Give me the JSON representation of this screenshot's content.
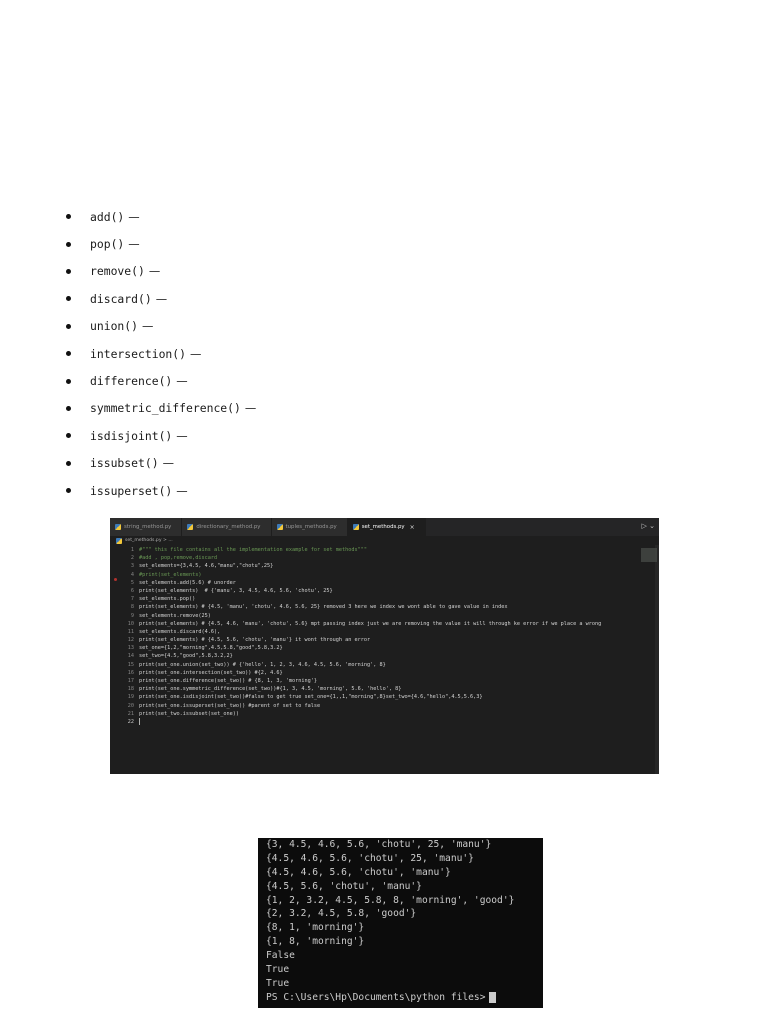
{
  "methods": [
    {
      "name": "add()",
      "dash": "—"
    },
    {
      "name": "pop()",
      "dash": "—"
    },
    {
      "name": "remove()",
      "dash": "—"
    },
    {
      "name": "discard()",
      "dash": "—"
    },
    {
      "name": "union()",
      "dash": "—"
    },
    {
      "name": "intersection()",
      "dash": "—"
    },
    {
      "name": "difference()",
      "dash": "—"
    },
    {
      "name": "symmetric_difference()",
      "dash": "—"
    },
    {
      "name": "isdisjoint()",
      "dash": "—"
    },
    {
      "name": "issubset()",
      "dash": "—"
    },
    {
      "name": "issuperset()",
      "dash": "—"
    }
  ],
  "editor": {
    "tabs": [
      {
        "label": "string_method.py",
        "active": false,
        "icon": "python-file-icon"
      },
      {
        "label": "directionary_method.py",
        "active": false,
        "icon": "python-file-icon"
      },
      {
        "label": "tuples_methods.py",
        "active": false,
        "icon": "python-file-icon"
      },
      {
        "label": "set_methods.py",
        "active": true,
        "icon": "python-file-icon"
      }
    ],
    "close_glyph": "×",
    "run_glyph": "▷ ⌄",
    "breadcrumb": "set_methods.py > ...",
    "lines": [
      {
        "num": "1",
        "text": "#\"\"\" this file contains all the implementation example for set methods\"\"\"",
        "kind": "comment"
      },
      {
        "num": "2",
        "text": "#add , pop,remove,discard",
        "kind": "comment"
      },
      {
        "num": "3",
        "text": "set_elements={3,4.5, 4.6,\"manu\",\"chotu\",25}",
        "kind": "code"
      },
      {
        "num": "4",
        "text": "#print(set_elements)",
        "kind": "comment"
      },
      {
        "num": "5",
        "text": "set_elements.add(5.6) # unorder",
        "kind": "code"
      },
      {
        "num": "6",
        "text": "print(set_elements)  # {'manu', 3, 4.5, 4.6, 5.6, 'chotu', 25}",
        "kind": "code"
      },
      {
        "num": "7",
        "text": "set_elements.pop()",
        "kind": "code"
      },
      {
        "num": "8",
        "text": "print(set_elements) # {4.5, 'manu', 'chotu', 4.6, 5.6, 25} removed 3 here we index we wont able to gave value in index",
        "kind": "code"
      },
      {
        "num": "9",
        "text": "set_elements.remove(25)",
        "kind": "code"
      },
      {
        "num": "10",
        "text": "print(set_elements) # {4.5, 4.6, 'manu', 'chotu', 5.6} mpt passing index just we are removing the value it will through ke error if we place a wrong",
        "kind": "code"
      },
      {
        "num": "11",
        "text": "set_elements.discard(4.6),",
        "kind": "code"
      },
      {
        "num": "12",
        "text": "print(set_elements) # {4.5, 5.6, 'chotu', 'manu'} it wont through an error",
        "kind": "code"
      },
      {
        "num": "13",
        "text": "set_one={1,2,\"morning\",4.5,5.8,\"good\",5.8,3.2}",
        "kind": "code"
      },
      {
        "num": "14",
        "text": "set_two={4.5,\"good\",5.8,3.2,2}",
        "kind": "code"
      },
      {
        "num": "15",
        "text": "print(set_one.union(set_two)) # {'hello', 1, 2, 3, 4.6, 4.5, 5.6, 'morning', 8}",
        "kind": "code"
      },
      {
        "num": "16",
        "text": "print(set_one.intersection(set_two)) #{2, 4.6}",
        "kind": "code"
      },
      {
        "num": "17",
        "text": "print(set_one.difference(set_two)) # {8, 1, 3, 'morning'}",
        "kind": "code"
      },
      {
        "num": "18",
        "text": "print(set_one.symmetric_difference(set_two))#{1, 3, 4.5, 'morning', 5.6, 'hello', 8}",
        "kind": "code"
      },
      {
        "num": "19",
        "text": "print(set_one.isdisjoint(set_two))#false to get true set_one={1,,1,\"morning\",8}set_two={4.6,\"hello\",4.5,5.6,3}",
        "kind": "code"
      },
      {
        "num": "20",
        "text": "print(set_one.issuperset(set_two)) #parent of set to false",
        "kind": "code"
      },
      {
        "num": "21",
        "text": "print(set_two.issubset(set_one))",
        "kind": "code"
      },
      {
        "num": "22",
        "text": "",
        "kind": "current"
      }
    ]
  },
  "terminal": {
    "lines": [
      "{3, 4.5, 4.6, 5.6, 'chotu', 25, 'manu'}",
      "{4.5, 4.6, 5.6, 'chotu', 25, 'manu'}",
      "{4.5, 4.6, 5.6, 'chotu', 'manu'}",
      "{4.5, 5.6, 'chotu', 'manu'}",
      "{1, 2, 3.2, 4.5, 5.8, 8, 'morning', 'good'}",
      "{2, 3.2, 4.5, 5.8, 'good'}",
      "{8, 1, 'morning'}",
      "{1, 8, 'morning'}",
      "False",
      "True",
      "True"
    ],
    "prompt": "PS C:\\Users\\Hp\\Documents\\python files>"
  },
  "colors": {
    "editor_bg": "#1e1e1e",
    "comment": "#6a9955",
    "terminal_bg": "#0c0c0c"
  }
}
